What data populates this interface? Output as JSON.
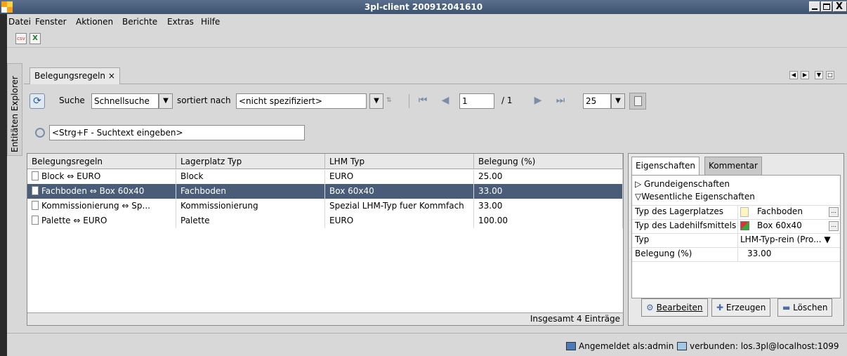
{
  "window": {
    "title": "3pl-client 200912041610",
    "logo_colors": [
      "#f7a21b",
      "#fcd24a",
      "#ffffff",
      "#f7a21b"
    ],
    "minimize_glyph": "_",
    "maximize_glyph": "□",
    "close_glyph": "X"
  },
  "menu": {
    "items": [
      {
        "label": "Datei"
      },
      {
        "label": "Fenster"
      },
      {
        "label": "Aktionen"
      },
      {
        "label": "Berichte"
      },
      {
        "label": "Extras"
      },
      {
        "label": "Hilfe"
      }
    ]
  },
  "toolbar": {
    "csv_icon_text": "csv",
    "excel_icon_text": "X"
  },
  "explorer_tab": {
    "label": "Entitäten Explorer"
  },
  "doc_tab": {
    "label": "Belegungsregeln ×"
  },
  "search": {
    "search_label": "Suche",
    "search_mode": "Schnellsuche",
    "sorted_label": "sortiert nach",
    "sort_value": "<nicht spezifiziert>",
    "page_value": "1",
    "page_total": "/ 1",
    "page_size": "25",
    "quick_search_placeholder": "<Strg+F - Suchtext eingeben>"
  },
  "table": {
    "columns": [
      "Belegungsregeln",
      "Lagerplatz Typ",
      "LHM Typ",
      "Belegung (%)"
    ],
    "rows": [
      {
        "name": "Block ⇔ EURO",
        "location_type": "Block",
        "lhm_type": "EURO",
        "occupancy": "25.00",
        "selected": false
      },
      {
        "name": "Fachboden ⇔ Box 60x40",
        "location_type": "Fachboden",
        "lhm_type": "Box 60x40",
        "occupancy": "33.00",
        "selected": true
      },
      {
        "name": "Kommissionierung ⇔ Sp...",
        "location_type": "Kommissionierung",
        "lhm_type": "Spezial LHM-Typ fuer Kommfach",
        "occupancy": "33.00",
        "selected": false
      },
      {
        "name": "Palette ⇔ EURO",
        "location_type": "Palette",
        "lhm_type": "EURO",
        "occupancy": "100.00",
        "selected": false
      }
    ],
    "footer": "Insgesamt 4 Einträge"
  },
  "properties": {
    "tabs": [
      "Eigenschaften",
      "Kommentar"
    ],
    "section_basic": "▷ Grundeigenschaften",
    "section_essential": "▽Wesentliche Eigenschaften",
    "rows": [
      {
        "key": "Typ des Lagerplatzes",
        "value": "Fachboden"
      },
      {
        "key": "Typ des Ladehilfsmittels",
        "value": "Box 60x40"
      },
      {
        "key": "Typ",
        "value": "LHM-Typ-rein (Pro... ▼"
      },
      {
        "key": "Belegung (%)",
        "value": "33.00"
      }
    ],
    "buttons": {
      "edit": "Bearbeiten",
      "create": "Erzeugen",
      "delete": "Löschen"
    }
  },
  "status": {
    "logged_in": "Angemeldet als:admin",
    "connected": "verbunden: los.3pl@localhost:1099"
  }
}
